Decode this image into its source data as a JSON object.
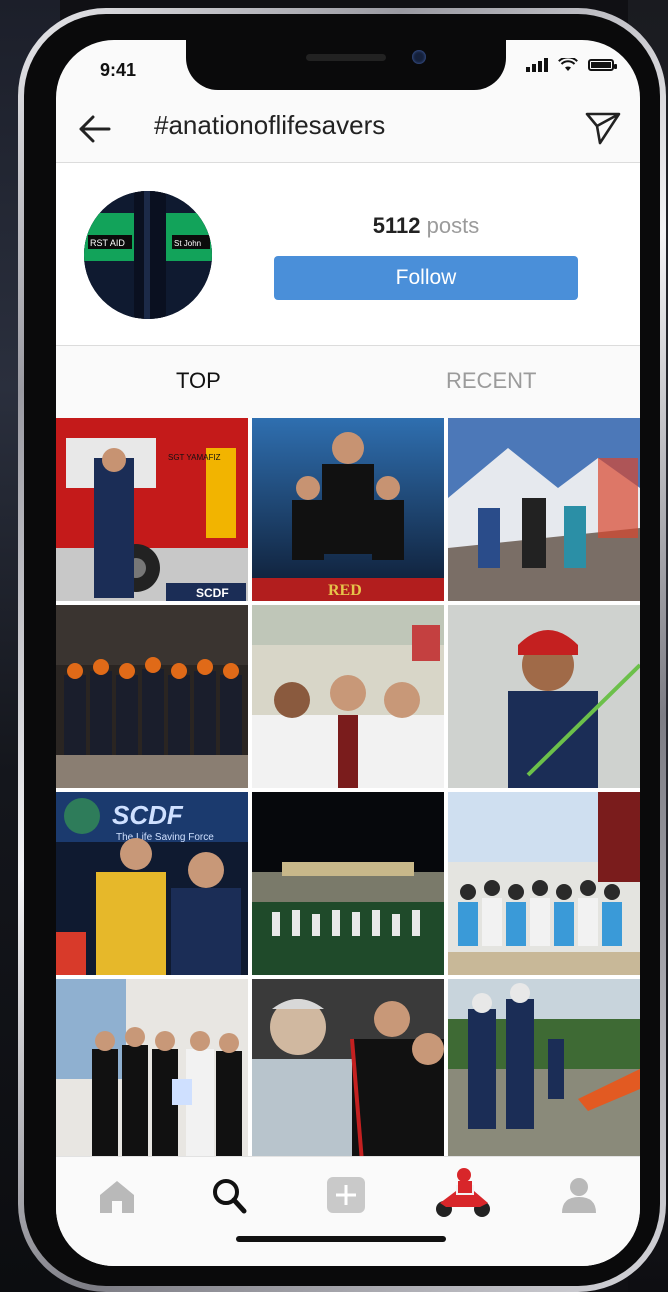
{
  "status_bar": {
    "time": "9:41"
  },
  "header": {
    "hashtag": "#anationoflifesavers"
  },
  "profile": {
    "post_count": "5112",
    "post_label": "posts",
    "follow_label": "Follow",
    "avatar_badge_left": "RST AID",
    "avatar_badge_right": "St John"
  },
  "tabs": [
    {
      "label": "TOP"
    },
    {
      "label": "RECENT"
    }
  ],
  "tiles": [
    {
      "overlay": "SCDF",
      "sublabel": "SGT YAMAFIZ"
    },
    {
      "overlay": "RED"
    },
    {
      "overlay": ""
    },
    {
      "overlay": ""
    },
    {
      "overlay": ""
    },
    {
      "overlay": ""
    },
    {
      "overlay": "SCDF",
      "sublabel": "The Life Saving Force"
    },
    {
      "overlay": ""
    },
    {
      "overlay": ""
    },
    {
      "overlay": ""
    },
    {
      "overlay": ""
    },
    {
      "overlay": ""
    }
  ],
  "colors": {
    "accent": "#4a8fd9",
    "follow_text": "#ffffff",
    "muted": "#9b9b9b"
  },
  "icons": [
    "back-arrow-icon",
    "send-icon",
    "home-icon",
    "search-icon",
    "add-post-icon",
    "activity-icon",
    "profile-icon"
  ]
}
